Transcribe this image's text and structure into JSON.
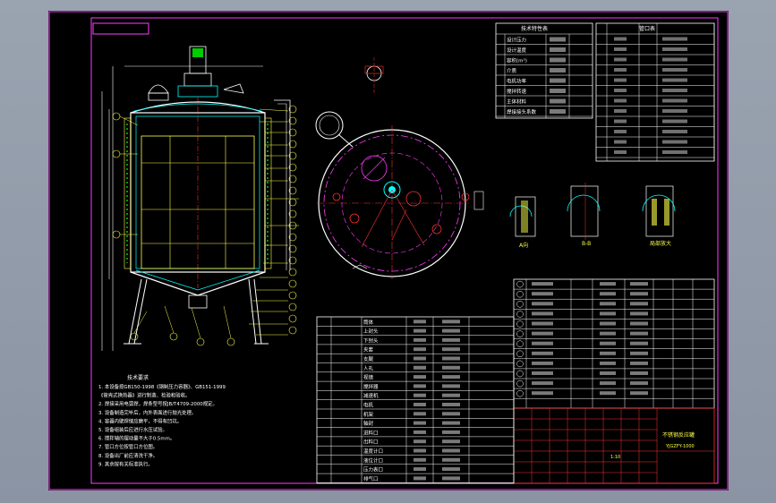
{
  "view": {
    "background": "#8d97a6",
    "sheet": "#000000"
  },
  "labels": {
    "tech_table_title": "技术特性表",
    "nozzle_table_title": "管口表",
    "notes_title": "技术要求",
    "design_pressure": "设计压力",
    "design_temp": "设计温度",
    "volume": "容积(m³)",
    "medium": "介质",
    "motor": "电机功率",
    "speed": "搅拌转速",
    "material": "主体材料",
    "weld": "焊接接头系数",
    "section_a": "A向",
    "section_b": "B-B",
    "section_c": "局部放大",
    "part_title": "不锈钢反应罐",
    "drawing_no": "YJGZFY-1000",
    "scale": "1:10"
  },
  "notes": [
    "1. 本设备按GB150-1998《钢制压力容器》、GB151-1999",
    "《管壳式换热器》进行制造、检验和验收。",
    "2. 焊接采用电弧焊，焊条型号按JB/T4709-2000规定。",
    "3. 设备制造完毕后，内外表面进行抛光处理。",
    "4. 容器内壁焊缝应磨平，不得有凹坑。",
    "5. 设备组装后应进行水压试验。",
    "6. 搅拌轴的摆动量不大于0.5mm。",
    "7. 管口方位按管口方位图。",
    "8. 设备出厂前应清洗干净。",
    "9. 其余按有关标准执行。"
  ],
  "parts_list": [
    "筒体",
    "上封头",
    "下封头",
    "夹套",
    "支腿",
    "人孔",
    "视镜",
    "搅拌器",
    "减速机",
    "电机",
    "机架",
    "轴封",
    "进料口",
    "出料口",
    "温度计口",
    "液位计口",
    "压力表口",
    "排气口"
  ]
}
